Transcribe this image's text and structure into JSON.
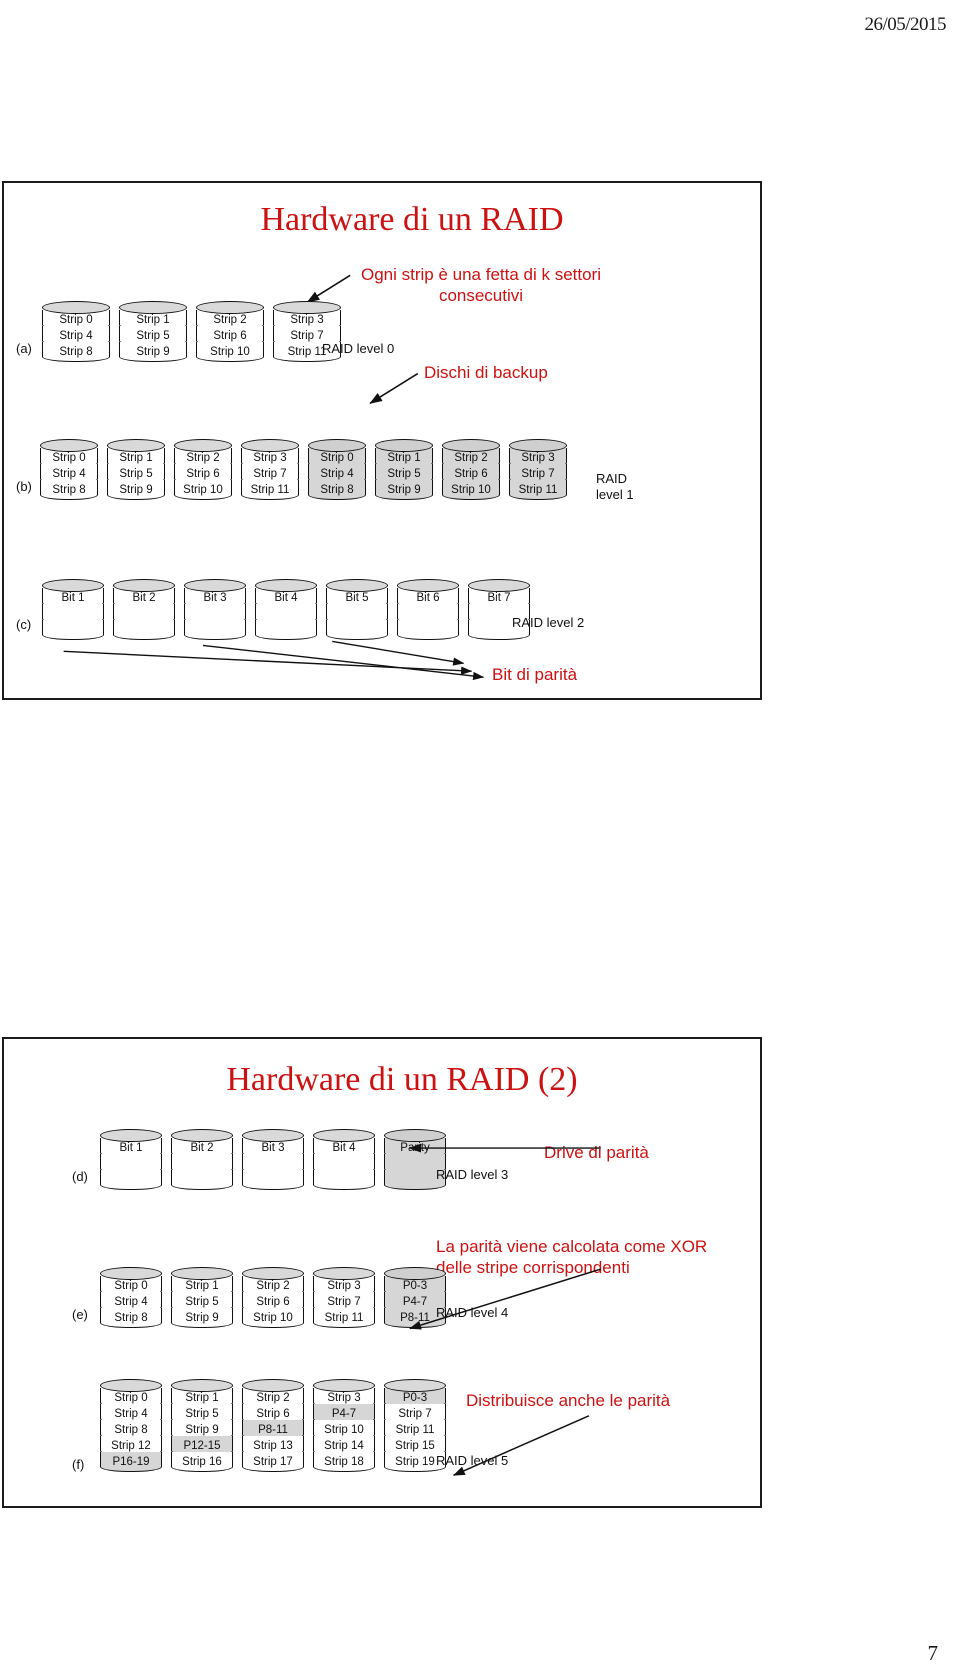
{
  "page": {
    "date": "26/05/2015",
    "number": "7",
    "accent_red": "#cc1111",
    "disk_shade": "#d6d6d6"
  },
  "slide1": {
    "title": "Hardware di un RAID",
    "callouts": {
      "strip_note": "Ogni strip è una fetta di k settori consecutivi",
      "backup_note": "Dischi di backup",
      "parity_bits": "Bit di parità"
    },
    "a": {
      "group": "(a)",
      "raid": "RAID level 0",
      "disks": [
        [
          "Strip 0",
          "Strip 4",
          "Strip 8"
        ],
        [
          "Strip 1",
          "Strip 5",
          "Strip 9"
        ],
        [
          "Strip 2",
          "Strip 6",
          "Strip 10"
        ],
        [
          "Strip 3",
          "Strip 7",
          "Strip 11"
        ]
      ]
    },
    "b": {
      "group": "(b)",
      "raid": "RAID\nlevel 1",
      "disks": [
        {
          "shaded": false,
          "cells": [
            "Strip 0",
            "Strip 4",
            "Strip 8"
          ]
        },
        {
          "shaded": false,
          "cells": [
            "Strip 1",
            "Strip 5",
            "Strip 9"
          ]
        },
        {
          "shaded": false,
          "cells": [
            "Strip 2",
            "Strip 6",
            "Strip 10"
          ]
        },
        {
          "shaded": false,
          "cells": [
            "Strip 3",
            "Strip 7",
            "Strip 11"
          ]
        },
        {
          "shaded": true,
          "cells": [
            "Strip 0",
            "Strip 4",
            "Strip 8"
          ]
        },
        {
          "shaded": true,
          "cells": [
            "Strip 1",
            "Strip 5",
            "Strip 9"
          ]
        },
        {
          "shaded": true,
          "cells": [
            "Strip 2",
            "Strip 6",
            "Strip 10"
          ]
        },
        {
          "shaded": true,
          "cells": [
            "Strip 3",
            "Strip 7",
            "Strip 11"
          ]
        }
      ]
    },
    "c": {
      "group": "(c)",
      "raid": "RAID level 2",
      "disks": [
        [
          "Bit 1",
          "",
          ""
        ],
        [
          "Bit 2",
          "",
          ""
        ],
        [
          "Bit 3",
          "",
          ""
        ],
        [
          "Bit 4",
          "",
          ""
        ],
        [
          "Bit 5",
          "",
          ""
        ],
        [
          "Bit 6",
          "",
          ""
        ],
        [
          "Bit 7",
          "",
          ""
        ]
      ]
    }
  },
  "slide2": {
    "title": "Hardware di un RAID (2)",
    "callouts": {
      "parity_drive": "Drive di parità",
      "xor_note": "La parità viene calcolata come XOR delle stripe corrispondenti",
      "distributed_note": "Distribuisce anche le parità"
    },
    "d": {
      "group": "(d)",
      "raid": "RAID level 3",
      "disks": [
        {
          "shaded": false,
          "cells": [
            "Bit 1",
            "",
            ""
          ]
        },
        {
          "shaded": false,
          "cells": [
            "Bit 2",
            "",
            ""
          ]
        },
        {
          "shaded": false,
          "cells": [
            "Bit 3",
            "",
            ""
          ]
        },
        {
          "shaded": false,
          "cells": [
            "Bit 4",
            "",
            ""
          ]
        },
        {
          "shaded": true,
          "cells": [
            "Parity",
            "",
            ""
          ]
        }
      ]
    },
    "e": {
      "group": "(e)",
      "raid": "RAID level 4",
      "disks": [
        {
          "shaded": false,
          "cells": [
            "Strip 0",
            "Strip 4",
            "Strip 8"
          ]
        },
        {
          "shaded": false,
          "cells": [
            "Strip 1",
            "Strip 5",
            "Strip 9"
          ]
        },
        {
          "shaded": false,
          "cells": [
            "Strip 2",
            "Strip 6",
            "Strip 10"
          ]
        },
        {
          "shaded": false,
          "cells": [
            "Strip 3",
            "Strip 7",
            "Strip 11"
          ]
        },
        {
          "shaded": true,
          "cells": [
            "P0-3",
            "P4-7",
            "P8-11"
          ]
        }
      ]
    },
    "f": {
      "group": "(f)",
      "raid": "RAID level 5",
      "disks": [
        {
          "cells": [
            {
              "t": "Strip 0",
              "p": false
            },
            {
              "t": "Strip 4",
              "p": false
            },
            {
              "t": "Strip 8",
              "p": false
            },
            {
              "t": "Strip 12",
              "p": false
            },
            {
              "t": "P16-19",
              "p": true
            }
          ]
        },
        {
          "cells": [
            {
              "t": "Strip 1",
              "p": false
            },
            {
              "t": "Strip 5",
              "p": false
            },
            {
              "t": "Strip 9",
              "p": false
            },
            {
              "t": "P12-15",
              "p": true
            },
            {
              "t": "Strip 16",
              "p": false
            }
          ]
        },
        {
          "cells": [
            {
              "t": "Strip 2",
              "p": false
            },
            {
              "t": "Strip 6",
              "p": false
            },
            {
              "t": "P8-11",
              "p": true
            },
            {
              "t": "Strip 13",
              "p": false
            },
            {
              "t": "Strip 17",
              "p": false
            }
          ]
        },
        {
          "cells": [
            {
              "t": "Strip 3",
              "p": false
            },
            {
              "t": "P4-7",
              "p": true
            },
            {
              "t": "Strip 10",
              "p": false
            },
            {
              "t": "Strip 14",
              "p": false
            },
            {
              "t": "Strip 18",
              "p": false
            }
          ]
        },
        {
          "cells": [
            {
              "t": "P0-3",
              "p": true
            },
            {
              "t": "Strip 7",
              "p": false
            },
            {
              "t": "Strip 11",
              "p": false
            },
            {
              "t": "Strip 15",
              "p": false
            },
            {
              "t": "Strip 19",
              "p": false
            }
          ]
        }
      ]
    }
  }
}
